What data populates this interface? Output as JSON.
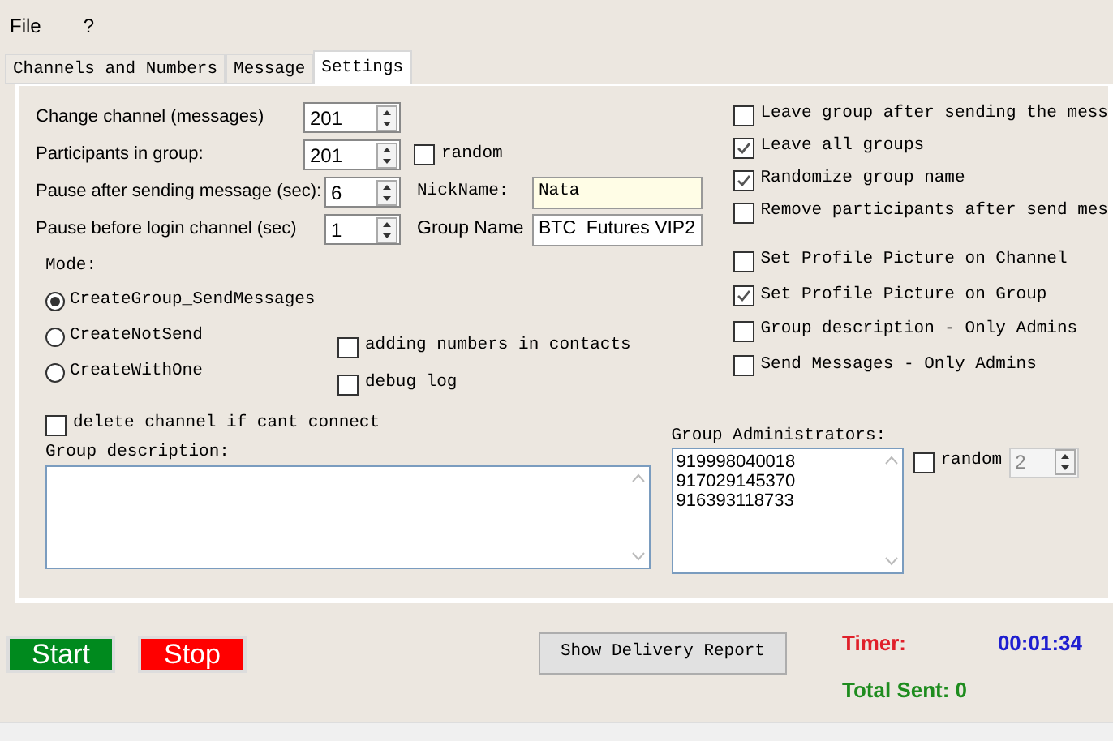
{
  "menu": [
    "File",
    "?"
  ],
  "tabs": [
    {
      "label": "Channels and Numbers",
      "selected": false
    },
    {
      "label": "Message",
      "selected": false
    },
    {
      "label": "Settings",
      "selected": true
    }
  ],
  "spinners": [
    {
      "label": "Change channel (messages)",
      "value": "201"
    },
    {
      "label": "Participants in group:",
      "value": "201"
    },
    {
      "label": "Pause after sending message (sec):",
      "value": "6"
    },
    {
      "label": "Pause before login channel (sec)",
      "value": "1"
    }
  ],
  "participants_random": {
    "label": "random",
    "checked": false
  },
  "nickname": {
    "label": "NickName:",
    "value": "Nata"
  },
  "group_name": {
    "label": "Group Name",
    "value": "BTC  Futures VIP2"
  },
  "mode": {
    "label": "Mode:",
    "options": [
      {
        "label": "CreateGroup_SendMessages",
        "selected": true
      },
      {
        "label": "CreateNotSend",
        "selected": false
      },
      {
        "label": "CreateWithOne",
        "selected": false
      }
    ]
  },
  "middle_options": [
    {
      "label": "adding numbers in contacts",
      "checked": false
    },
    {
      "label": "debug log",
      "checked": false
    }
  ],
  "delete_channel": {
    "label": "delete channel if cant connect",
    "checked": false
  },
  "right_options": [
    {
      "label": "Leave group after sending the mess",
      "checked": false
    },
    {
      "label": "Leave all groups",
      "checked": true
    },
    {
      "label": "Randomize group name",
      "checked": true
    },
    {
      "label": "Remove participants after send mes",
      "checked": false
    }
  ],
  "right_options_2": [
    {
      "label": "Set Profile Picture on Channel",
      "checked": false
    },
    {
      "label": "Set Profile Picture on Group",
      "checked": true
    },
    {
      "label": "Group description - Only Admins",
      "checked": false
    },
    {
      "label": "Send Messages - Only Admins",
      "checked": false
    }
  ],
  "group_description": {
    "label": "Group description:"
  },
  "group_admins": {
    "label": "Group Administrators:",
    "lines": [
      "919998040018",
      "917029145370",
      "916393118733"
    ],
    "random": {
      "label": "random",
      "checked": false
    },
    "count": "2"
  },
  "buttons": {
    "start": "Start",
    "stop": "Stop",
    "report": "Show Delivery Report"
  },
  "timer": {
    "label": "Timer:",
    "value": "00:01:34"
  },
  "total_sent": "Total Sent: 0"
}
